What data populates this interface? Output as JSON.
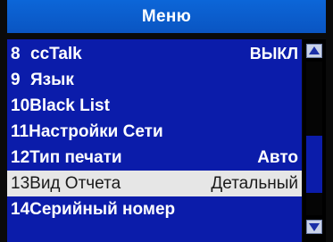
{
  "title": "Меню",
  "menu": {
    "items": [
      {
        "number": "8",
        "label": "ccTalk",
        "value": "ВЫКЛ"
      },
      {
        "number": "9",
        "label": "Язык",
        "value": ""
      },
      {
        "number": "10",
        "label": "Black List",
        "value": ""
      },
      {
        "number": "11",
        "label": "Настройки Сети",
        "value": ""
      },
      {
        "number": "12",
        "label": "Тип печати",
        "value": "Авто"
      },
      {
        "number": "13",
        "label": "Вид Отчета",
        "value": "Детальный"
      },
      {
        "number": "14",
        "label": "Серийный номер",
        "value": ""
      }
    ],
    "selected_index": 5
  },
  "scrollbar": {
    "position_fraction": 0.77,
    "visible_fraction": 0.37
  },
  "colors": {
    "title_bg": "#0c66d8",
    "menu_bg": "#0b1caa",
    "selected_bg": "#e6e6e6",
    "text": "#ffffff"
  },
  "icons": {
    "scroll_up": "up-arrow-icon",
    "scroll_down": "down-arrow-icon"
  }
}
